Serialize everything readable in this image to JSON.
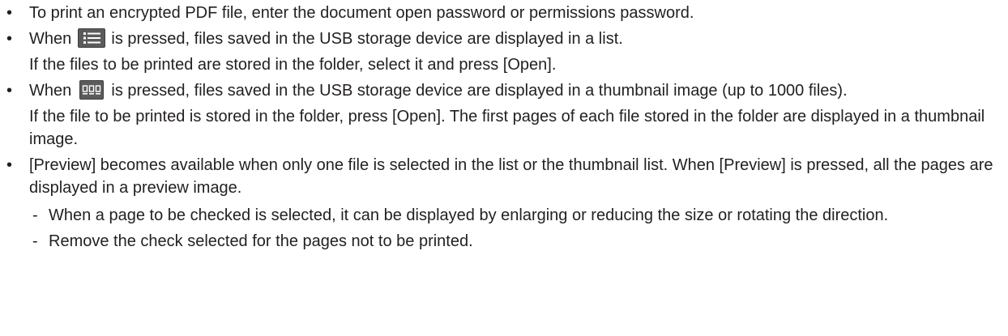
{
  "bullets": [
    {
      "text": "To print an encrypted PDF file, enter the document open password or permissions password."
    },
    {
      "before_icon": "When",
      "icon": "list-view-icon",
      "after_icon": "is pressed, files saved in the USB storage device are displayed in a list.",
      "line2": "If the files to be printed are stored in the folder, select it and press [Open]."
    },
    {
      "before_icon": "When",
      "icon": "thumbnail-view-icon",
      "after_icon": "is pressed, files saved in the USB storage device are displayed in a thumbnail image (up to 1000 files).",
      "line2": "If the file to be printed is stored in the folder, press [Open]. The first pages of each file stored in the folder are displayed in a thumbnail image."
    },
    {
      "text": "[Preview] becomes available when only one file is selected in the list or the thumbnail list. When [Preview] is pressed, all the pages are displayed in a preview image.",
      "sub_items": [
        "When a page to be checked is selected, it can be displayed by enlarging or reducing the size or rotating the direction.",
        "Remove the check selected for the pages not to be printed."
      ]
    }
  ],
  "bullet_glyph": "•",
  "dash_glyph": "-",
  "colors": {
    "text": "#231f20",
    "icon_bg": "#5b5b5b",
    "icon_fg": "#ffffff"
  }
}
